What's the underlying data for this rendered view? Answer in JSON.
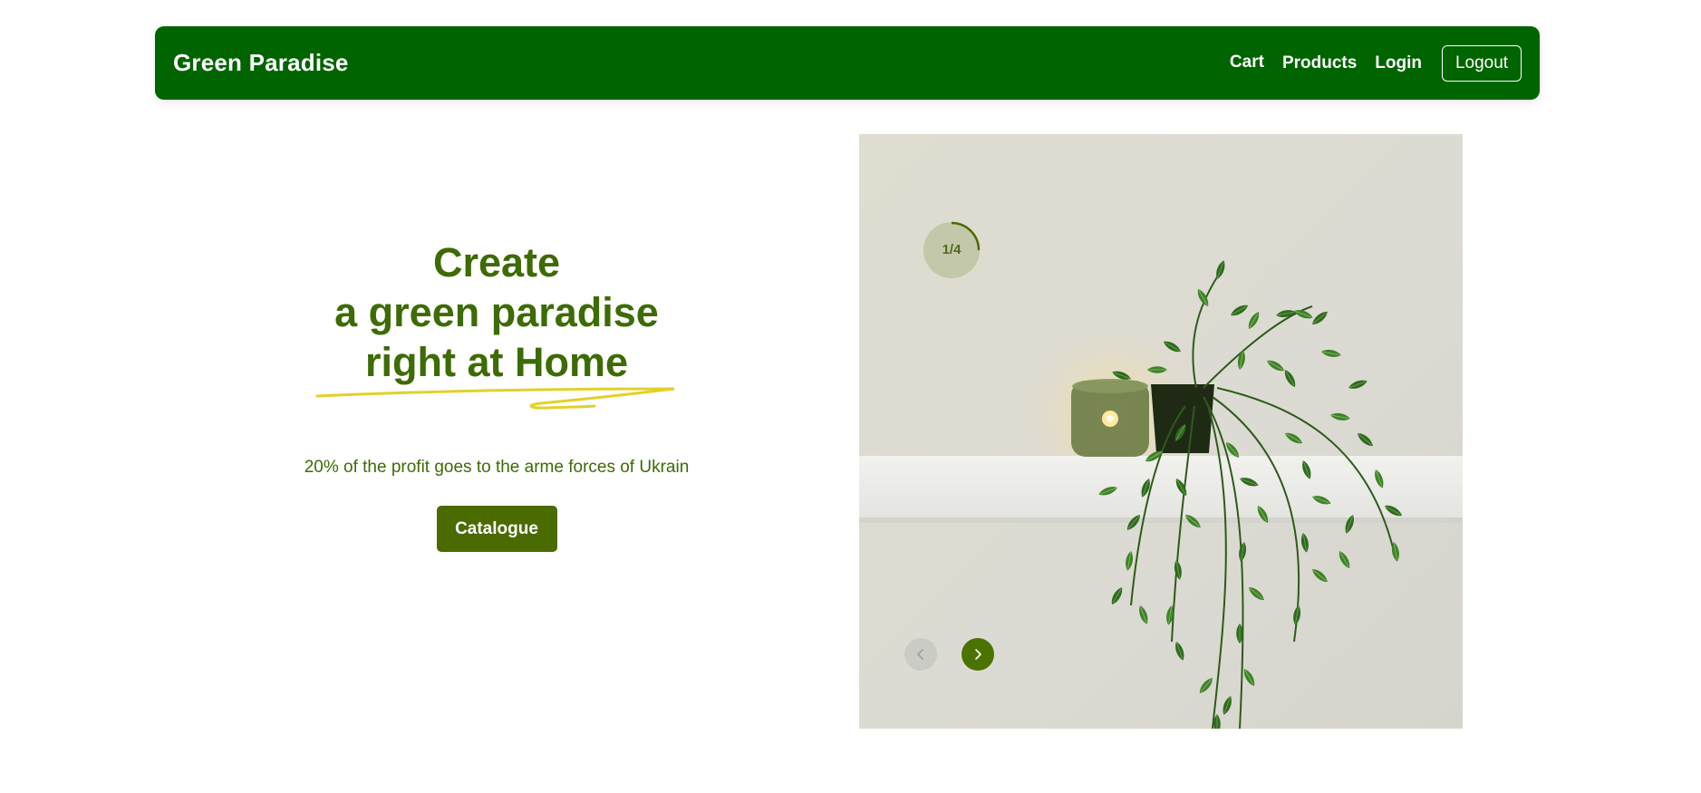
{
  "navbar": {
    "brand": "Green Paradise",
    "links": {
      "cart": "Cart",
      "products": "Products",
      "login": "Login"
    },
    "logout_label": "Logout"
  },
  "hero": {
    "title_line1": "Create",
    "title_line2": "a green paradise",
    "title_line3": "right at Home",
    "subtitle": "20% of the profit goes to the arme forces of Ukrain",
    "cta_label": "Catalogue"
  },
  "slider": {
    "counter": "1/4",
    "current": 1,
    "total": 4,
    "progress": 0.25,
    "prev_icon": "chevron-left-icon",
    "next_icon": "chevron-right-icon"
  },
  "colors": {
    "navbar_bg": "#006400",
    "heading_text": "#3d6b04",
    "button_bg": "#4b6b00",
    "scribble": "#e2d12a",
    "active_arrow": "#4b7300"
  }
}
